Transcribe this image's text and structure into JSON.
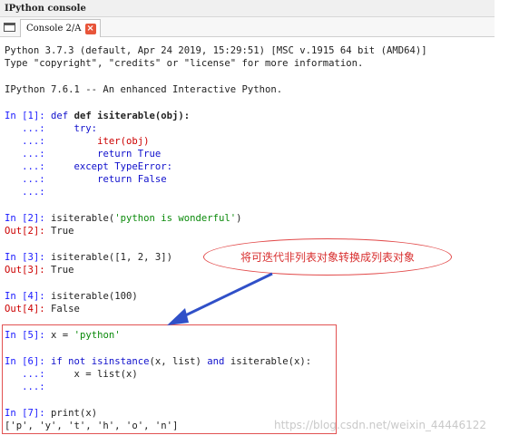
{
  "window": {
    "title": "IPython console",
    "tab_label": "Console 2/A",
    "tab_close": "×"
  },
  "banner": {
    "line1": "Python 3.7.3 (default, Apr 24 2019, 15:29:51) [MSC v.1915 64 bit (AMD64)]",
    "line2": "Type \"copyright\", \"credits\" or \"license\" for more information.",
    "line3": "IPython 7.6.1 -- An enhanced Interactive Python."
  },
  "cells": {
    "in1_prompt": "In [1]:",
    "in1_code": "def isiterable(obj):",
    "cont": "...:",
    "try_line": "try:",
    "iter_line": "iter(obj)",
    "return_true": "return True",
    "except_line": "except TypeError:",
    "return_false": "return False",
    "in2_prompt": "In [2]:",
    "in2_code_a": "isiterable(",
    "in2_str": "'python is wonderful'",
    "in2_code_b": ")",
    "out2_prompt": "Out[2]:",
    "out2_value": "True",
    "in3_prompt": "In [3]:",
    "in3_code": "isiterable([1, 2, 3])",
    "out3_prompt": "Out[3]:",
    "out3_value": "True",
    "in4_prompt": "In [4]:",
    "in4_code": "isiterable(100)",
    "out4_prompt": "Out[4]:",
    "out4_value": "False",
    "in5_prompt": "In [5]:",
    "in5_code_a": "x = ",
    "in5_str": "'python'",
    "in6_prompt": "In [6]:",
    "in6_if": "if not",
    "in6_isinstance": "isinstance",
    "in6_mid": "(x, list)",
    "in6_and": "and",
    "in6_tail": "isiterable(x):",
    "in6_body": "x = list(x)",
    "in7_prompt": "In [7]:",
    "in7_code": "print(x)",
    "out7_output": "['p', 'y', 't', 'h', 'o', 'n']"
  },
  "annotation": {
    "callout_text": "将可迭代非列表对象转换成列表对象",
    "callout_color": "#e24a4a"
  },
  "watermark": "https://blog.csdn.net/weixin_44446122"
}
